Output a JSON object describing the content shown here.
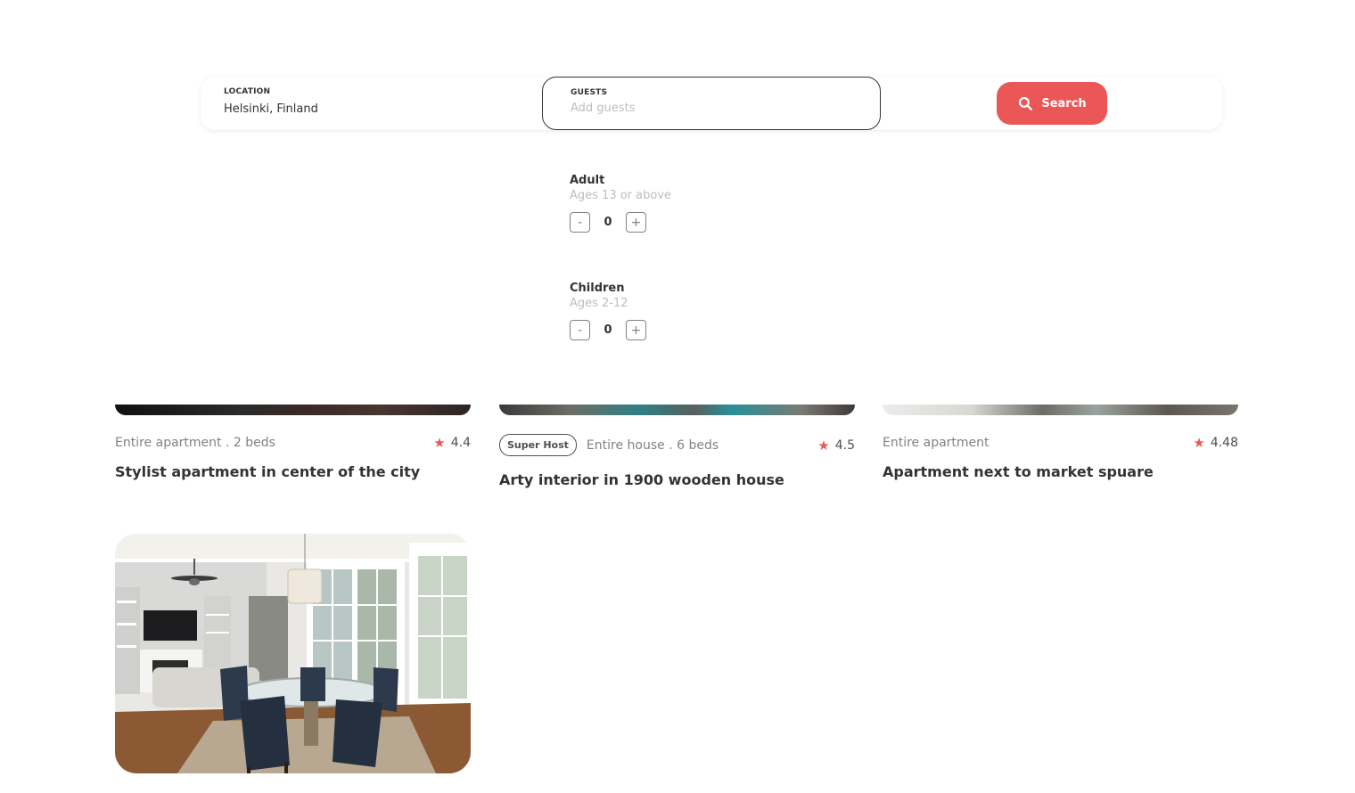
{
  "search": {
    "location_label": "LOCATION",
    "location_value": "Helsinki, Finland",
    "guests_label": "GUESTS",
    "guests_placeholder": "Add guests",
    "button_label": "Search"
  },
  "guests_panel": {
    "adult": {
      "title": "Adult",
      "subtitle": "Ages 13 or above",
      "count": "0",
      "minus": "-",
      "plus": "+"
    },
    "children": {
      "title": "Children",
      "subtitle": "Ages 2-12",
      "count": "0",
      "minus": "-",
      "plus": "+"
    }
  },
  "stays": [
    {
      "type": "Entire apartment . 2 beds",
      "rating": "4.4",
      "title": "Stylist apartment in center of the city"
    },
    {
      "badge": "Super Host",
      "type": "Entire house . 6 beds",
      "rating": "4.5",
      "title": "Arty interior in 1900 wooden house"
    },
    {
      "type": "Entire apartment",
      "rating": "4.48",
      "title": "Apartment next to market spuare"
    }
  ],
  "colors": {
    "accent": "#eb5757",
    "text": "#333333",
    "muted": "#828282",
    "placeholder": "#bdbdbd"
  },
  "icons": {
    "search": "search-icon",
    "star": "star-icon"
  }
}
